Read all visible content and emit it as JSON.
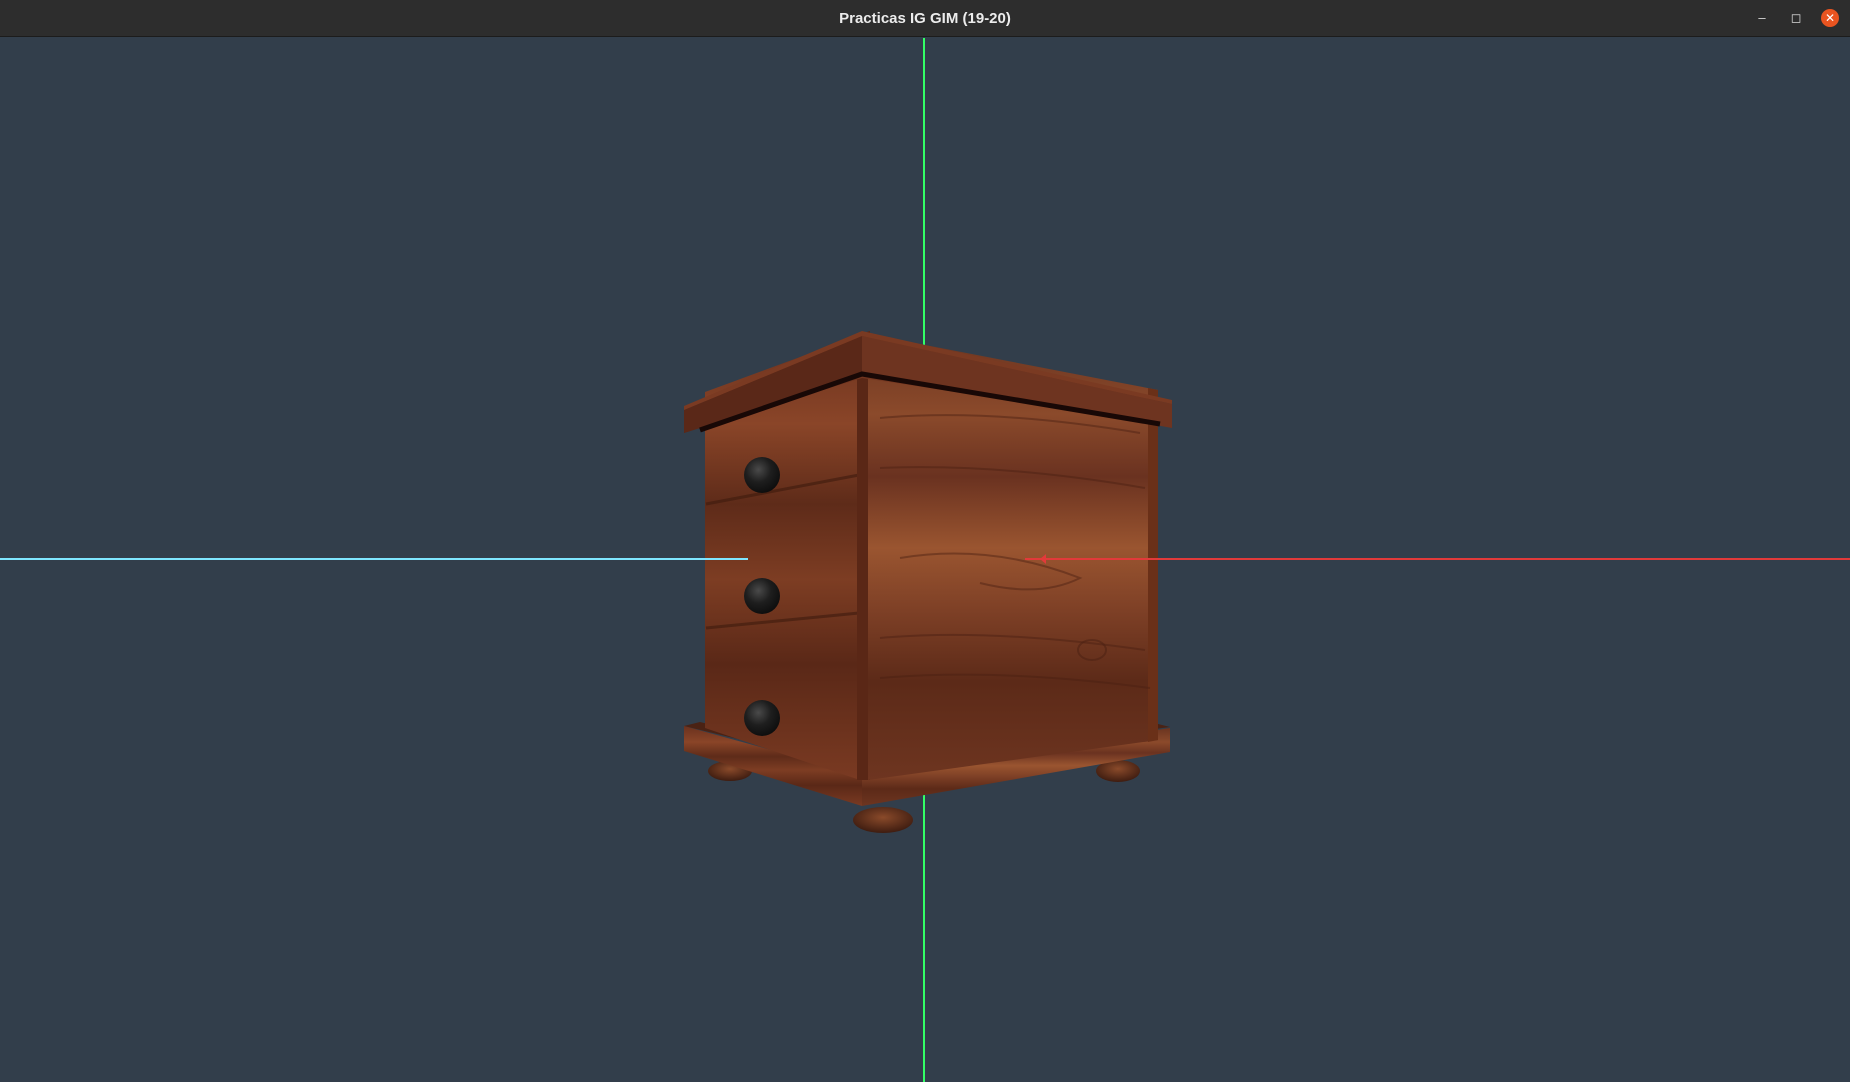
{
  "window": {
    "title": "Practicas IG GIM (19-20)",
    "controls": {
      "minimize": "–",
      "maximize": "◻",
      "close": "✕"
    }
  },
  "scene": {
    "background_color": "#323e4b",
    "object": "wooden nightstand with three round black knobs",
    "axes": {
      "x_color": "#e23a3a",
      "y_color": "#33ff66",
      "z_color": "#7fe6ff"
    },
    "wood_colors": {
      "light": "#8a4a2a",
      "mid": "#6e3520",
      "dark": "#4a2214"
    },
    "knob_color": "#1e1e1e"
  }
}
